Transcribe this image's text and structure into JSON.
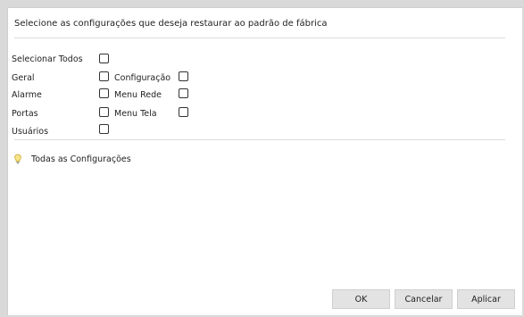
{
  "header": {
    "title": "Selecione as configurações que deseja restaurar ao padrão de fábrica"
  },
  "options": {
    "select_all": {
      "label": "Selecionar Todos",
      "checked": false
    },
    "general": {
      "label": "Geral",
      "checked": false
    },
    "configuration": {
      "label": "Configuração",
      "checked": false
    },
    "alarm": {
      "label": "Alarme",
      "checked": false
    },
    "network_menu": {
      "label": "Menu Rede",
      "checked": false
    },
    "ports": {
      "label": "Portas",
      "checked": false
    },
    "display_menu": {
      "label": "Menu Tela",
      "checked": false
    },
    "users": {
      "label": "Usuários",
      "checked": false
    }
  },
  "tip": {
    "icon": "lightbulb-icon",
    "text": "Todas as Configurações"
  },
  "footer": {
    "ok_label": "OK",
    "cancel_label": "Cancelar",
    "apply_label": "Aplicar"
  }
}
